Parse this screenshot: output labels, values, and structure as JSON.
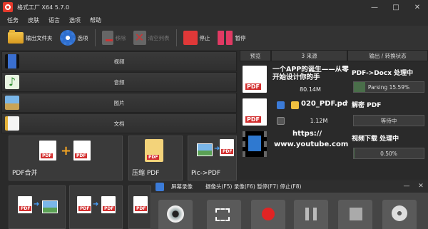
{
  "window": {
    "title": "格式工厂 X64 5.7.0",
    "controls": [
      "—",
      "□",
      "✕"
    ]
  },
  "menu": [
    "任务",
    "皮肤",
    "语言",
    "选项",
    "帮助"
  ],
  "toolbar": {
    "output_folder": "输出文件夹",
    "options": "选项",
    "remove": "移除",
    "clear_list": "清空列表",
    "stop": "停止",
    "pause": "暂停"
  },
  "categories": [
    "视频",
    "音频",
    "图片",
    "文档"
  ],
  "tiles": [
    {
      "label": "PDF合并"
    },
    {
      "label": "压缩 PDF"
    },
    {
      "label": "Pic->PDF"
    }
  ],
  "task_headers": {
    "preview": "预览",
    "source": "3 来源",
    "status": "输出 / 转换状态"
  },
  "tasks": [
    {
      "name": "一个APP的诞生——从零开始设计你的手",
      "size": "80.14M",
      "status_title": "PDF->Docx 处理中",
      "status_text": "Parsing 15.59%",
      "progress": 15.59
    },
    {
      "name": "020_PDF.pdf",
      "size": "1.12M",
      "status_title": "解密 PDF",
      "status_text": "等待中",
      "progress": 0
    },
    {
      "name_line1": "https://",
      "name_line2": "www.youtube.com",
      "status_title": "视频下载 处理中",
      "status_text": "0.50%",
      "progress": 0.5
    }
  ],
  "recorder": {
    "title": "屏幕录像",
    "shortcuts": "摄像头(F5) 录像(F6) 暂停(F7) 停止(F8)",
    "controls": [
      "—",
      "✕"
    ]
  },
  "icons": {
    "accent": "#e53a2c",
    "stop_color": "#e03838",
    "pause_color": "#e03a63"
  }
}
